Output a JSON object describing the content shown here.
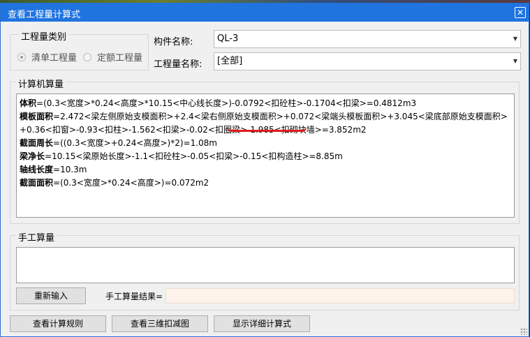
{
  "window": {
    "title": "查看工程量计算式",
    "close_label": "✕"
  },
  "quantity_type": {
    "legend": "工程量类别",
    "options": [
      {
        "label": "清单工程量",
        "checked": true
      },
      {
        "label": "定额工程量",
        "checked": false
      }
    ]
  },
  "component_name": {
    "label": "构件名称:",
    "value": "QL-3"
  },
  "quantity_name": {
    "label": "工程量名称:",
    "value": "[全部]"
  },
  "computer_calc": {
    "legend": "计算机算量",
    "lines": [
      {
        "name": "体积",
        "formula": "=(0.3<宽度>*0.24<高度>*10.15<中心线长度>)-0.0792<扣砼柱>-0.1704<扣梁>=0.4812m3"
      },
      {
        "name": "模板面积",
        "formula": "=2.472<梁左侧原始支模面积>+2.4<梁右侧原始支模面积>+0.072<梁端头模板面积>+3.045<梁底部原始支模面积>+0.36<扣窗>-0.93<扣柱>-1.562<扣梁>-0.02<扣圈梁>-1.985<扣砌块墙>=3.852m2"
      },
      {
        "name": "截面周长",
        "formula": "=((0.3<宽度>+0.24<高度>)*2)=1.08m"
      },
      {
        "name": "梁净长",
        "formula": "=10.15<梁原始长度>-1.1<扣砼柱>-0.05<扣梁>-0.15<扣构造柱>=8.85m"
      },
      {
        "name": "轴线长度",
        "formula": "=10.3m"
      },
      {
        "name": "截面面积",
        "formula": "=(0.3<宽度>*0.24<高度>)=0.072m2"
      }
    ]
  },
  "manual_calc": {
    "legend": "手工算量",
    "input_value": "",
    "reenter_label": "重新输入",
    "result_label": "手工算量结果=",
    "result_value": ""
  },
  "footer": {
    "view_rules_label": "查看计算规则",
    "view_3d_label": "查看三维扣减图",
    "show_detail_label": "显示详细计算式"
  },
  "colors": {
    "titlebar": "#1f74e0",
    "annotation": "#e21b1b",
    "result_bg": "#fdf3ea"
  }
}
